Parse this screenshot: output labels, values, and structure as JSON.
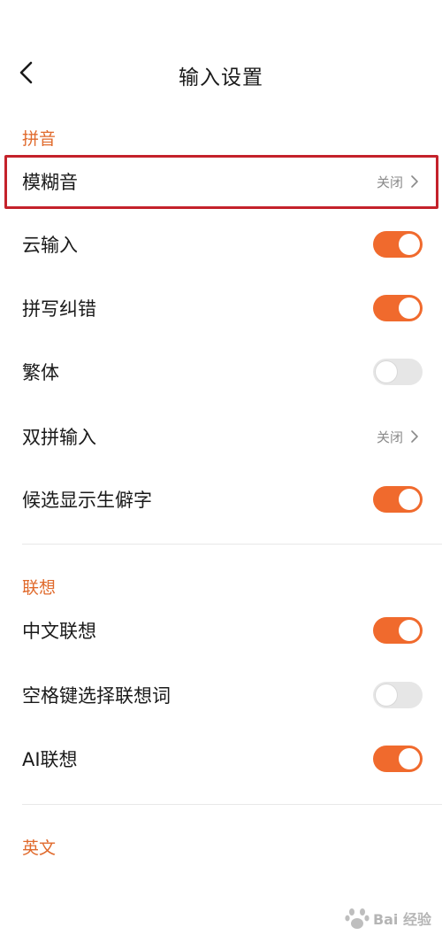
{
  "header": {
    "title": "输入设置",
    "back_icon": "chevron-left-icon"
  },
  "colors": {
    "accent": "#f06a2d",
    "section_label": "#e06a2c",
    "highlight": "#c4222b",
    "toggle_off": "#e6e6e6"
  },
  "sections": {
    "pinyin": {
      "label": "拼音",
      "fuzzy": {
        "label": "模糊音",
        "value": "关闭"
      },
      "cloud": {
        "label": "云输入",
        "toggle": "on"
      },
      "spell": {
        "label": "拼写纠错",
        "toggle": "on"
      },
      "traditional": {
        "label": "繁体",
        "toggle": "off"
      },
      "shuangpin": {
        "label": "双拼输入",
        "value": "关闭"
      },
      "rare": {
        "label": "候选显示生僻字",
        "toggle": "on"
      }
    },
    "assoc": {
      "label": "联想",
      "chinese": {
        "label": "中文联想",
        "toggle": "on"
      },
      "space": {
        "label": "空格键选择联想词",
        "toggle": "off"
      },
      "ai": {
        "label": "AI联想",
        "toggle": "on"
      }
    },
    "english": {
      "label": "英文"
    }
  },
  "watermark": {
    "text": "Bai 经验"
  }
}
